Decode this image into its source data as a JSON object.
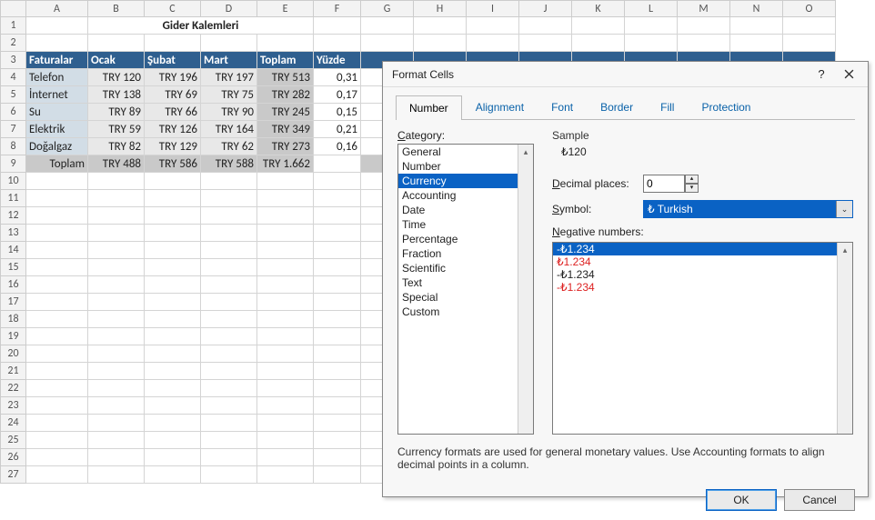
{
  "sheet": {
    "title": "Gider Kalemleri",
    "col_headers": [
      "A",
      "B",
      "C",
      "D",
      "E",
      "F",
      "G",
      "H",
      "I",
      "J",
      "K",
      "L",
      "M",
      "N",
      "O"
    ],
    "row_count": 27,
    "header_row": [
      "Faturalar",
      "Ocak",
      "Şubat",
      "Mart",
      "Toplam",
      "Yüzde"
    ],
    "rows": [
      {
        "name": "Telefon",
        "ocak": "TRY 120",
        "subat": "TRY 196",
        "mart": "TRY 197",
        "toplam": "TRY 513",
        "pct": "0,31"
      },
      {
        "name": "İnternet",
        "ocak": "TRY 138",
        "subat": "TRY 69",
        "mart": "TRY 75",
        "toplam": "TRY 282",
        "pct": "0,17"
      },
      {
        "name": "Su",
        "ocak": "TRY 89",
        "subat": "TRY 66",
        "mart": "TRY 90",
        "toplam": "TRY 245",
        "pct": "0,15"
      },
      {
        "name": "Elektrik",
        "ocak": "TRY 59",
        "subat": "TRY 126",
        "mart": "TRY 164",
        "toplam": "TRY 349",
        "pct": "0,21"
      },
      {
        "name": "Doğalgaz",
        "ocak": "TRY 82",
        "subat": "TRY 129",
        "mart": "TRY 62",
        "toplam": "TRY 273",
        "pct": "0,16"
      }
    ],
    "total_row": {
      "name": "Toplam",
      "ocak": "TRY 488",
      "subat": "TRY 586",
      "mart": "TRY 588",
      "toplam": "TRY 1.662"
    }
  },
  "dialog": {
    "title": "Format Cells",
    "help": "?",
    "tabs": [
      "Number",
      "Alignment",
      "Font",
      "Border",
      "Fill",
      "Protection"
    ],
    "active_tab": 0,
    "category_label": "Category:",
    "categories": [
      "General",
      "Number",
      "Currency",
      "Accounting",
      "Date",
      "Time",
      "Percentage",
      "Fraction",
      "Scientific",
      "Text",
      "Special",
      "Custom"
    ],
    "selected_category_index": 2,
    "sample_label": "Sample",
    "sample_value": "₺120",
    "decimal_label": "Decimal places:",
    "decimal_value": "0",
    "symbol_label": "Symbol:",
    "symbol_value": "₺ Turkish",
    "negative_label": "Negative numbers:",
    "negative_options": [
      {
        "text": "-₺1.234",
        "red": false,
        "sel": true
      },
      {
        "text": "₺1.234",
        "red": true,
        "sel": false
      },
      {
        "text": "-₺1.234",
        "red": false,
        "sel": false
      },
      {
        "text": "-₺1.234",
        "red": true,
        "sel": false
      }
    ],
    "explain": "Currency formats are used for general monetary values.  Use Accounting formats to align decimal points in a column.",
    "ok": "OK",
    "cancel": "Cancel"
  }
}
